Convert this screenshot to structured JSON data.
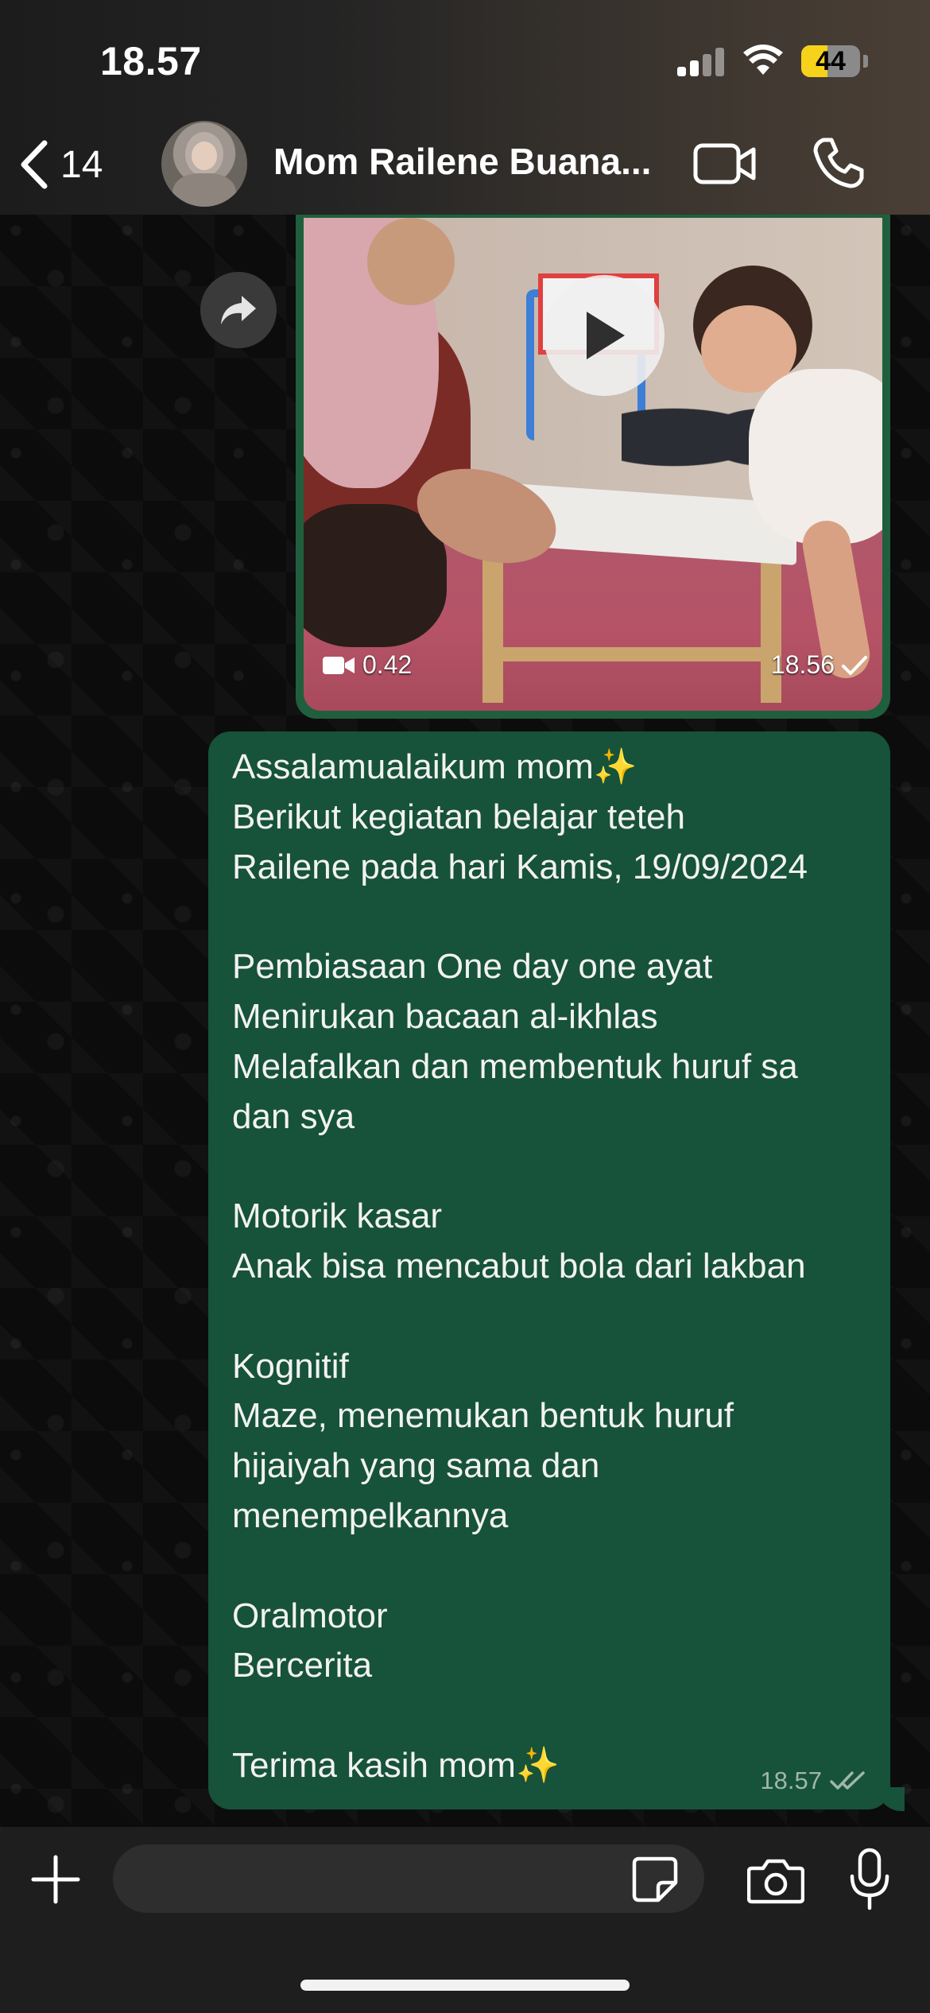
{
  "status_bar": {
    "time": "18.57",
    "battery": "44",
    "battery_level": 0.44
  },
  "header": {
    "back_count": "14",
    "contact_name": "Mom Railene Buana...",
    "icons": [
      "chevron-left-icon",
      "video-call-icon",
      "phone-icon"
    ]
  },
  "video_message": {
    "duration": "0.42",
    "time": "18.56",
    "status": "sent-single-check"
  },
  "text_message": {
    "body": "Assalamualaikum mom✨\nBerikut kegiatan belajar teteh\nRailene pada hari Kamis, 19/09/2024\n\nPembiasaan One day one ayat\nMenirukan bacaan al-ikhlas\nMelafalkan dan membentuk huruf sa\ndan sya\n\nMotorik kasar\nAnak bisa mencabut bola dari lakban\n\nKognitif\nMaze, menemukan bentuk huruf\nhijaiyah yang sama dan\nmenempelkannya\n\nOralmotor\nBercerita\n\nTerima kasih mom✨",
    "time": "18.57",
    "status": "delivered-double-check"
  },
  "composer": {
    "input_value": "",
    "icons": [
      "plus-icon",
      "sticker-icon",
      "camera-icon",
      "microphone-icon"
    ]
  },
  "colors": {
    "outgoing_bubble": "#17523a",
    "header_bg": "#242424",
    "battery_accent": "#f7d21a"
  }
}
